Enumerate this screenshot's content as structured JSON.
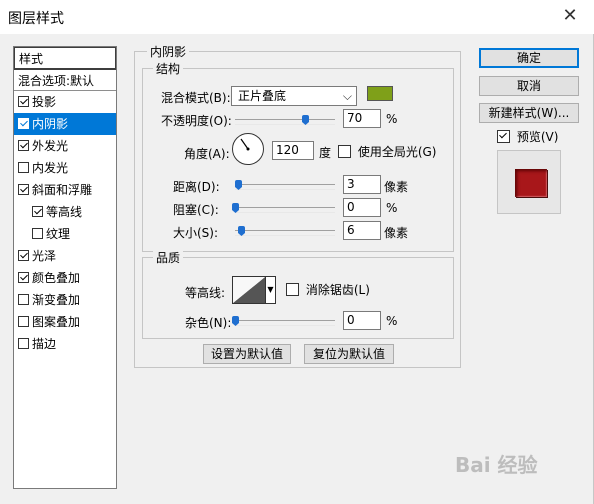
{
  "window": {
    "title": "图层样式",
    "close_glyph": "✕"
  },
  "left": {
    "header": "样式",
    "blend": "混合选项:默认",
    "items": [
      {
        "label": "投影",
        "checked": true
      },
      {
        "label": "内阴影",
        "checked": true,
        "selected": true
      },
      {
        "label": "外发光",
        "checked": true
      },
      {
        "label": "内发光",
        "checked": false
      },
      {
        "label": "斜面和浮雕",
        "checked": true
      },
      {
        "label": "等高线",
        "checked": true,
        "sub": true
      },
      {
        "label": "纹理",
        "checked": false,
        "sub": true
      },
      {
        "label": "光泽",
        "checked": true
      },
      {
        "label": "颜色叠加",
        "checked": true
      },
      {
        "label": "渐变叠加",
        "checked": false
      },
      {
        "label": "图案叠加",
        "checked": false
      },
      {
        "label": "描边",
        "checked": false
      }
    ]
  },
  "panel": {
    "title": "内阴影",
    "structure": "结构",
    "blend_mode_label": "混合模式(B):",
    "blend_mode_value": "正片叠底",
    "shadow_color": "#7fa019",
    "opacity_label": "不透明度(O):",
    "opacity_value": "70",
    "percent": "%",
    "angle_label": "角度(A):",
    "angle_value": "120",
    "degree": "度",
    "global_light": "使用全局光(G)",
    "distance_label": "距离(D):",
    "distance_value": "3",
    "size_unit": "像素",
    "choke_label": "阻塞(C):",
    "choke_value": "0",
    "size_label": "大小(S):",
    "size_value": "6",
    "quality": "品质",
    "contour_label": "等高线:",
    "antialias": "消除锯齿(L)",
    "noise_label": "杂色(N):",
    "noise_value": "0",
    "set_default": "设置为默认值",
    "reset_default": "复位为默认值"
  },
  "right": {
    "ok": "确定",
    "cancel": "取消",
    "new_style": "新建样式(W)...",
    "preview": "预览(V)"
  },
  "watermark": "Bai 经验"
}
